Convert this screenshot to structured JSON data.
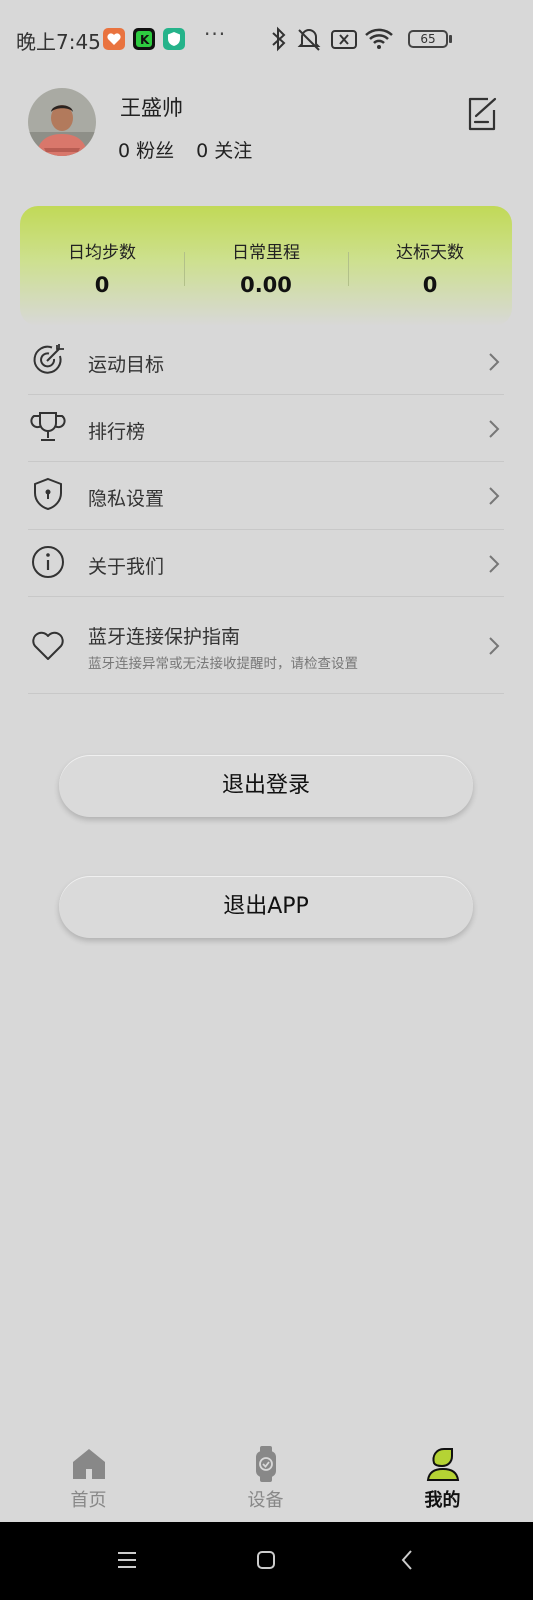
{
  "status_bar": {
    "time": "晚上7:45",
    "more": "···",
    "battery": "65"
  },
  "profile": {
    "name": "王盛帅",
    "fans_count": "0",
    "fans_label": "粉丝",
    "follow_count": "0",
    "follow_label": "关注"
  },
  "stats": [
    {
      "label": "日均步数",
      "value": "0"
    },
    {
      "label": "日常里程",
      "value": "0.00"
    },
    {
      "label": "达标天数",
      "value": "0"
    }
  ],
  "menu": [
    {
      "label": "运动目标",
      "icon": "target-icon"
    },
    {
      "label": "排行榜",
      "icon": "trophy-icon"
    },
    {
      "label": "隐私设置",
      "icon": "shield-lock-icon"
    },
    {
      "label": "关于我们",
      "icon": "info-icon"
    },
    {
      "label": "蓝牙连接保护指南",
      "sub": "蓝牙连接异常或无法接收提醒时，请检查设置",
      "icon": "heart-icon"
    }
  ],
  "buttons": {
    "logout": "退出登录",
    "exit_app": "退出APP"
  },
  "tabs": [
    {
      "label": "首页",
      "icon": "home-icon",
      "active": false
    },
    {
      "label": "设备",
      "icon": "watch-icon",
      "active": false
    },
    {
      "label": "我的",
      "icon": "user-icon",
      "active": true
    }
  ],
  "colors": {
    "accent": "#b5d334",
    "background": "#d8d8d8",
    "card_gradient_top": "#c1d957"
  }
}
